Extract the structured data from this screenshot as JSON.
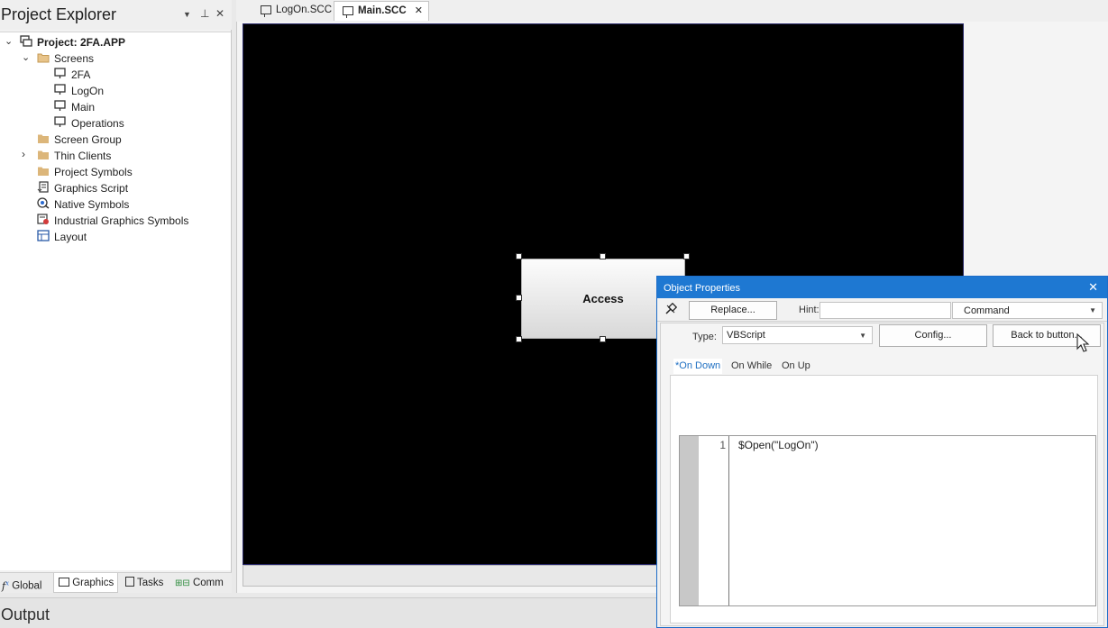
{
  "explorer": {
    "title": "Project Explorer",
    "menu_icon": "dropdown-triangle-icon",
    "pin_icon": "pin-icon",
    "close_label": "✕",
    "tree": [
      {
        "label": "Project: 2FA.APP",
        "icon": "project-icon",
        "expanded": true
      },
      {
        "label": "Screens",
        "icon": "folder-open-icon",
        "expanded": true
      },
      {
        "label": "2FA",
        "icon": "screen-icon"
      },
      {
        "label": "LogOn",
        "icon": "screen-icon"
      },
      {
        "label": "Main",
        "icon": "screen-icon"
      },
      {
        "label": "Operations",
        "icon": "screen-icon"
      },
      {
        "label": "Screen Group",
        "icon": "folder-icon"
      },
      {
        "label": "Thin Clients",
        "icon": "folder-icon",
        "expanded": false
      },
      {
        "label": "Project Symbols",
        "icon": "folder-icon"
      },
      {
        "label": "Graphics Script",
        "icon": "script-icon"
      },
      {
        "label": "Native Symbols",
        "icon": "native-symbols-icon"
      },
      {
        "label": "Industrial Graphics Symbols",
        "icon": "industrial-symbols-icon"
      },
      {
        "label": "Layout",
        "icon": "layout-icon"
      }
    ],
    "tabs": [
      {
        "label": "Global",
        "icon": "global-icon"
      },
      {
        "label": "Graphics",
        "icon": "graphics-icon",
        "active": true
      },
      {
        "label": "Tasks",
        "icon": "tasks-icon"
      },
      {
        "label": "Comm",
        "icon": "comm-icon"
      }
    ]
  },
  "documents": {
    "tabs": [
      {
        "label": "LogOn.SCC",
        "icon": "screen-icon"
      },
      {
        "label": "Main.SCC",
        "icon": "screen-icon",
        "active": true,
        "close_label": "✕"
      }
    ]
  },
  "canvas": {
    "background": "#000000",
    "button_label": "Access"
  },
  "output": {
    "title": "Output"
  },
  "object_properties": {
    "title": "Object Properties",
    "close_label": "✕",
    "replace_label": "Replace...",
    "hint_label": "Hint:",
    "hint_value": "",
    "command_value": "Command",
    "type_label": "Type:",
    "type_value": "VBScript",
    "config_label": "Config...",
    "back_label": "Back to button...",
    "script_tabs": [
      {
        "label": "*On Down",
        "active": true
      },
      {
        "label": "On While"
      },
      {
        "label": "On Up"
      }
    ],
    "code": {
      "line_number": "1",
      "text": "$Open(\"LogOn\")"
    },
    "accent_color": "#1e78d2"
  }
}
